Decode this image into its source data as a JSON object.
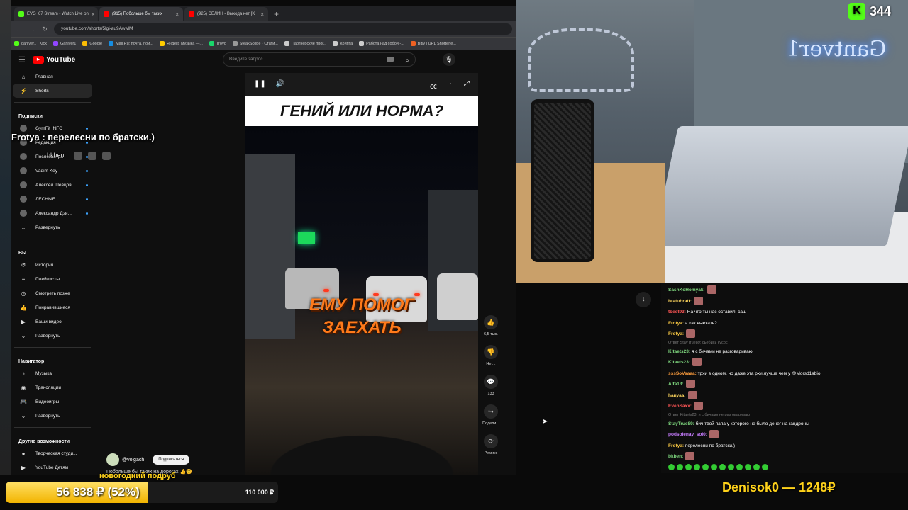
{
  "tabs": [
    {
      "label": "EVG_67 Stream - Watch Live on",
      "color": "#53fc18",
      "active": false
    },
    {
      "label": "(915) Побольше бы таких",
      "color": "#ff0000",
      "active": true
    },
    {
      "label": "(925) СЕЛИН - Выхода нет [K",
      "color": "#ff0000",
      "active": false
    }
  ],
  "newtab": "+",
  "address": {
    "back": "←",
    "forward": "→",
    "reload": "↻",
    "url": "youtube.com/shorts/5lgi-au9AwMM"
  },
  "bookmarks": [
    {
      "label": "ganiver1 | Kick",
      "color": "#53fc18"
    },
    {
      "label": "Ganiver1",
      "color": "#9146ff"
    },
    {
      "label": "Google",
      "color": "#fbbc05"
    },
    {
      "label": "Mail.Ru: почта, пои...",
      "color": "#168de2"
    },
    {
      "label": "Яндекс Музыка —...",
      "color": "#ffcc00"
    },
    {
      "label": "Trovo",
      "color": "#19d66b"
    },
    {
      "label": "SteakScope · Стати...",
      "color": "#999999"
    },
    {
      "label": "Партнерские прог...",
      "color": "#cccccc"
    },
    {
      "label": "Крипта",
      "color": "#cccccc"
    },
    {
      "label": "Работа над собой -...",
      "color": "#cccccc"
    },
    {
      "label": "Bitly | URL Shortene...",
      "color": "#ee6123"
    }
  ],
  "youtube": {
    "logo": "YouTube",
    "search_placeholder": "Введите запрос",
    "sidebar": {
      "main": [
        {
          "label": "Главная",
          "icon": "⌂"
        },
        {
          "label": "Shorts",
          "icon": "⚡"
        }
      ],
      "subs_header": "Подписки",
      "subs": [
        {
          "label": "GymFit INFO"
        },
        {
          "label": "Редакция"
        },
        {
          "label": "Послезавтра"
        },
        {
          "label": "Vadim Key"
        },
        {
          "label": "Алексей Шевцов"
        },
        {
          "label": "ЛЕСНЫЕ"
        },
        {
          "label": "Александр Дзи..."
        }
      ],
      "expand1": "Развернуть",
      "you_header": "Вы",
      "you": [
        {
          "label": "История",
          "icon": "↺"
        },
        {
          "label": "Плейлисты",
          "icon": "≡"
        },
        {
          "label": "Смотреть позже",
          "icon": "◷"
        },
        {
          "label": "Понравившиеся",
          "icon": "👍"
        },
        {
          "label": "Ваши видео",
          "icon": "▶"
        }
      ],
      "expand2": "Развернуть",
      "nav_header": "Навигатор",
      "nav": [
        {
          "label": "Музыка",
          "icon": "♪"
        },
        {
          "label": "Трансляции",
          "icon": "◉"
        },
        {
          "label": "Видеоигры",
          "icon": "🎮"
        }
      ],
      "expand3": "Развернуть",
      "more_header": "Другие возможности",
      "more": [
        {
          "label": "Творческая студи...",
          "icon": "●"
        },
        {
          "label": "YouTube Детям",
          "icon": "▶"
        }
      ]
    },
    "video": {
      "title": "ГЕНИЙ ИЛИ НОРМА?",
      "caption_line1": "ЕМУ ПОМОГ",
      "caption_line2": "ЗАЕХАТЬ",
      "channel": "@volgach",
      "subscribe": "Подписаться",
      "description": "Побольше бы таких на дорогах 👍😊"
    },
    "actions": [
      {
        "icon": "👍",
        "label": "6,5 тыс."
      },
      {
        "icon": "👎",
        "label": "Не ..."
      },
      {
        "icon": "💬",
        "label": "133"
      },
      {
        "icon": "↪",
        "label": "Подели..."
      },
      {
        "icon": "⟳",
        "label": "Ремикс"
      }
    ]
  },
  "overlay_message": "Frotya : перелесни по братски.)",
  "overlay_user": "bkben :",
  "camera": {
    "neon_sign": "Gantver1"
  },
  "kick_viewers": "344",
  "chat": [
    {
      "user": "SashKoHomyak:",
      "color": "#7fd87f",
      "text": "",
      "emote": true
    },
    {
      "user": "bratubratt:",
      "color": "#ffd75e",
      "text": "",
      "emote": true
    },
    {
      "user": "tbest93:",
      "color": "#ff5555",
      "text": " На что ты нас оставил, саш",
      "emote": false
    },
    {
      "user": "Frotya:",
      "color": "#f5c542",
      "text": " а как выехать?",
      "emote": false
    },
    {
      "user": "Frotya:",
      "color": "#f5c542",
      "text": "",
      "emote": true
    },
    {
      "reply": "Ответ StayTrue89: сьебись кусос"
    },
    {
      "user": "Kitaets23:",
      "color": "#7fd87f",
      "text": " я с бичами не разговариваю",
      "emote": false
    },
    {
      "user": "Kitaets23:",
      "color": "#7fd87f",
      "text": "",
      "emote": true
    },
    {
      "user": "sssSoVaaaa:",
      "color": "#ff9e3d",
      "text": " трхи в одном, но даже эта рхи лучше чем у @Morsd1abio",
      "emote": false
    },
    {
      "user": "Alfa13:",
      "color": "#7fd87f",
      "text": "",
      "emote": true
    },
    {
      "user": "hanyaa:",
      "color": "#ffd75e",
      "text": "",
      "emote": true
    },
    {
      "user": "EvenSaxx:",
      "color": "#ff5555",
      "text": "",
      "emote": true
    },
    {
      "reply": "Ответ Kitaets23: я с бичами не разговариваю"
    },
    {
      "user": "StayTrue89:",
      "color": "#7fd87f",
      "text": " бич твой папа у которого не было денег на гандроны",
      "emote": false
    },
    {
      "user": "podsolenay_sol0:",
      "color": "#c77dff",
      "text": "",
      "emote": true
    },
    {
      "user": "Frotya:",
      "color": "#f5c542",
      "text": " перелесни по братски.)",
      "emote": false
    },
    {
      "user": "bkben:",
      "color": "#7fd87f",
      "text": "",
      "emote": true
    }
  ],
  "goal": {
    "title": "новогодний подруб",
    "current_text": "56 838 ₽ (52%)",
    "max_text": "110 000 ₽",
    "percent": 52
  },
  "donor": "Denisok0 — 1248₽"
}
